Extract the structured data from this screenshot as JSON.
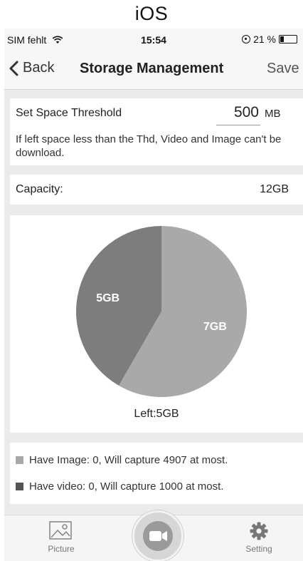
{
  "platform_label": "iOS",
  "status_bar": {
    "carrier": "SIM fehlt",
    "time": "15:54",
    "battery_text": "21 %",
    "battery_level": 0.21
  },
  "nav": {
    "back_label": "Back",
    "title": "Storage Management",
    "save_label": "Save"
  },
  "threshold": {
    "label": "Set Space Threshold",
    "value": "500",
    "unit": "MB",
    "description": "If left space less than the Thd, Video and Image can't be download."
  },
  "capacity": {
    "label": "Capacity:",
    "value": "12GB"
  },
  "storage_chart": {
    "left_label": "Left:5GB",
    "slice_used_label": "7GB",
    "slice_left_label": "5GB"
  },
  "chart_data": {
    "type": "pie",
    "categories": [
      "7GB",
      "5GB"
    ],
    "values": [
      7,
      5
    ],
    "colors": [
      "#a9a9a9",
      "#7d7d7d"
    ],
    "title": "",
    "start": "top",
    "direction": "clockwise"
  },
  "legend": {
    "image_text": "Have Image: 0, Will capture 4907 at most.",
    "video_text": "Have video: 0, Will capture 1000 at most.",
    "image_color": "#a9a9a9",
    "video_color": "#555555"
  },
  "tabbar": {
    "picture_label": "Picture",
    "setting_label": "Setting",
    "picture_icon": "picture-icon",
    "camera_icon": "video-camera-icon",
    "setting_icon": "gear-icon"
  }
}
